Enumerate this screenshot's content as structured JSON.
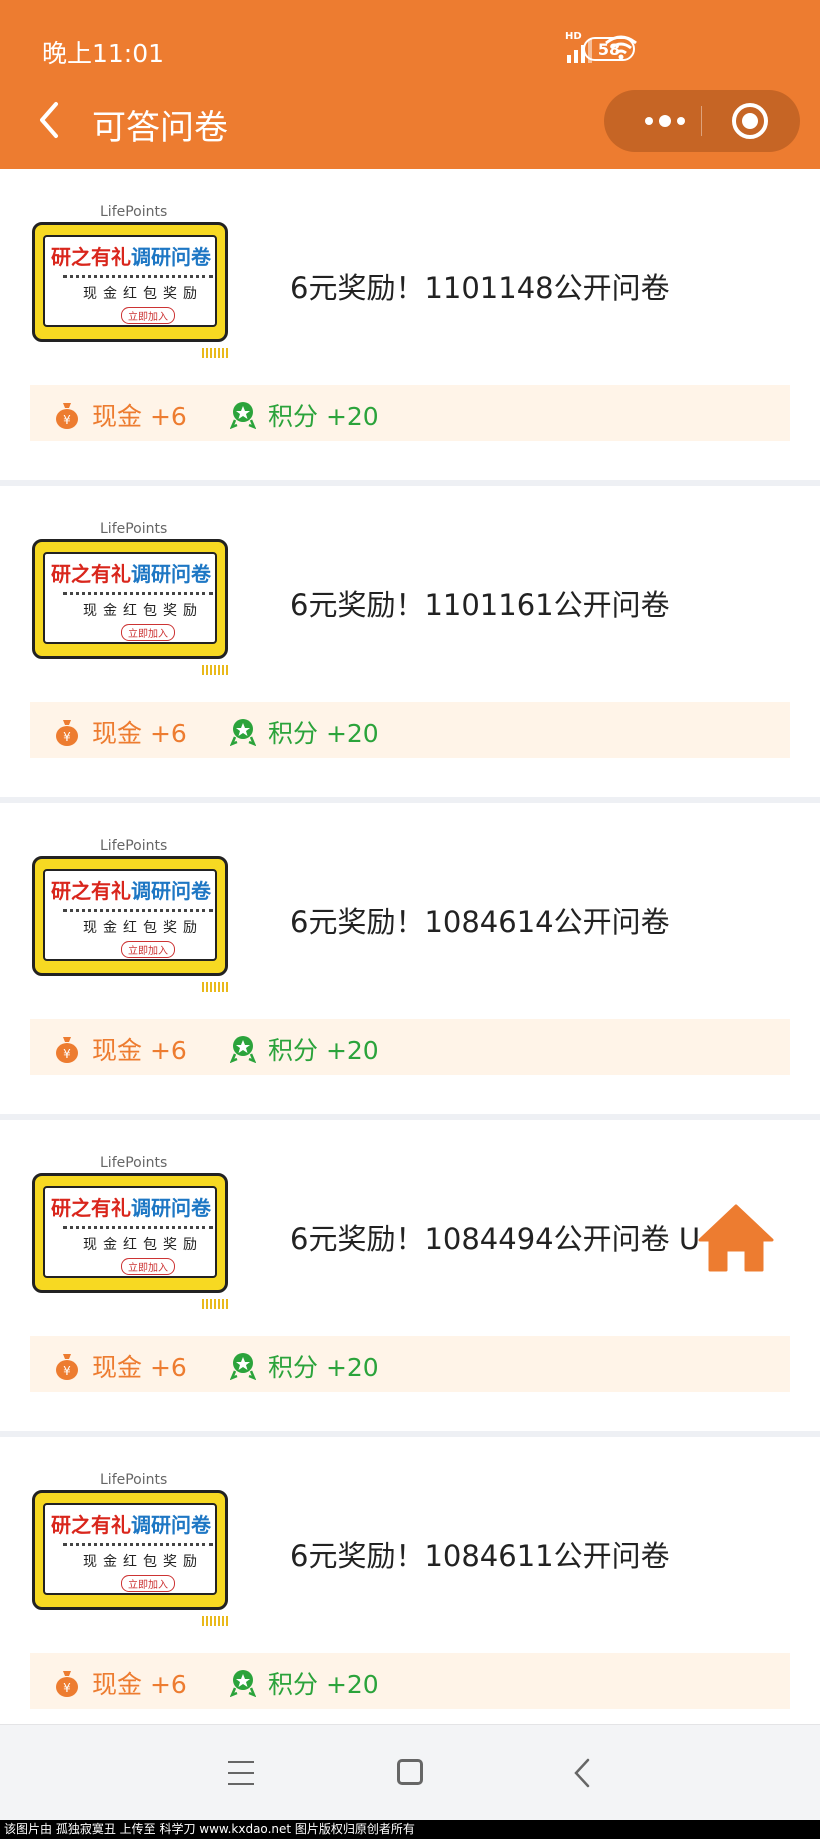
{
  "status_bar": {
    "time": "晚上11:01",
    "network_label": "HD",
    "battery": "58"
  },
  "nav": {
    "title": "可答问卷"
  },
  "thumbnail": {
    "brand": "LifePoints",
    "headline_red": "研之有礼",
    "headline_blue": "调研问卷",
    "subline": "现金红包奖励",
    "button": "立即加入"
  },
  "surveys": [
    {
      "title": "6元奖励！1101148公开问卷",
      "cash": "现金 +6",
      "points": "积分 +20"
    },
    {
      "title": "6元奖励！1101161公开问卷",
      "cash": "现金 +6",
      "points": "积分 +20"
    },
    {
      "title": "6元奖励！1084614公开问卷",
      "cash": "现金 +6",
      "points": "积分 +20"
    },
    {
      "title": "6元奖励！1084494公开问卷 U",
      "cash": "现金 +6",
      "points": "积分 +20"
    },
    {
      "title": "6元奖励！1084611公开问卷",
      "cash": "现金 +6",
      "points": "积分 +20"
    }
  ],
  "icons": {
    "back": "chevron-left-icon",
    "more": "more-dots-icon",
    "close": "target-close-icon",
    "cash": "money-bag-icon",
    "points": "badge-icon",
    "home": "home-icon"
  },
  "colors": {
    "header": "#ED7C30",
    "capsule": "#C66525",
    "cash_text": "#ED7C30",
    "points_text": "#2BA33B",
    "reward_bg": "#FFF4E8"
  },
  "watermark": "该图片由 孤独寂寞丑 上传至 科学刀 www.kxdao.net 图片版权归原创者所有"
}
